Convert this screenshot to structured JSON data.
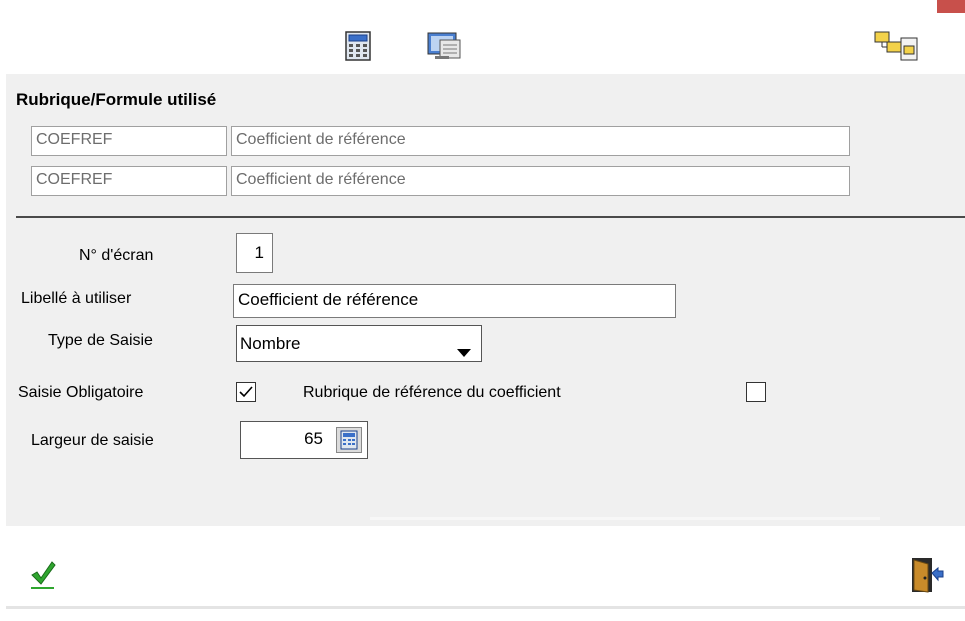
{
  "toolbar": {
    "icons": [
      "calculator-icon",
      "screen-preview-icon",
      "tree-structure-icon"
    ]
  },
  "section": {
    "title": "Rubrique/Formule utilisé"
  },
  "rubriques": [
    {
      "code": "COEFREF",
      "label": "Coefficient de référence"
    },
    {
      "code": "COEFREF",
      "label": "Coefficient de référence"
    }
  ],
  "form": {
    "ecran_label": "N° d'écran",
    "ecran_value": "1",
    "libelle_label": "Libellé à utiliser",
    "libelle_value": "Coefficient de référence",
    "type_label": "Type de Saisie",
    "type_value": "Nombre",
    "obligatoire_label": "Saisie Obligatoire",
    "obligatoire_checked": true,
    "ref_label": "Rubrique de référence du coefficient",
    "ref_checked": false,
    "largeur_label": "Largeur de saisie",
    "largeur_value": "65"
  },
  "footer": {
    "icons": [
      "validate-check-icon",
      "exit-door-icon"
    ]
  }
}
